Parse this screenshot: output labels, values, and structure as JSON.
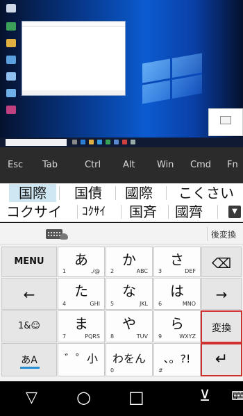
{
  "desktop": {
    "icons": [
      {
        "name": "recycle-bin-icon",
        "caption": ""
      },
      {
        "name": "app-icon",
        "caption": ""
      },
      {
        "name": "file-icon",
        "caption": ""
      },
      {
        "name": "app-icon",
        "caption": ""
      },
      {
        "name": "computer-icon",
        "caption": ""
      },
      {
        "name": "network-icon",
        "caption": ""
      },
      {
        "name": "app-icon",
        "caption": ""
      }
    ],
    "notepad": {
      "title": "",
      "menu": "",
      "text": "",
      "status": ""
    },
    "thumbnail_text": "",
    "taskbar": {
      "search_placeholder": "",
      "tray": ""
    }
  },
  "function_keys": [
    "Esc",
    "Tab",
    "Ctrl",
    "Alt",
    "Win",
    "Cmd",
    "Fn"
  ],
  "candidates": {
    "row1": [
      "国際",
      "国債",
      "國際",
      "こくさい"
    ],
    "row2": [
      "コクサイ",
      "ｺｸｻｲ",
      "国斉",
      "國齊"
    ],
    "selected_index": 0
  },
  "toolbar": {
    "gohenkan": "後変換"
  },
  "keyboard": {
    "menu": "MENU",
    "backspace": "⌫",
    "left": "←",
    "right": "→",
    "mode_123": "1&☺",
    "henkan": "変換",
    "mode_kana": "あA",
    "enter": "↵",
    "keys": [
      {
        "main": "あ",
        "num": "1",
        "sub": "./@"
      },
      {
        "main": "か",
        "num": "2",
        "sub": "ABC"
      },
      {
        "main": "さ",
        "num": "3",
        "sub": "DEF"
      },
      {
        "main": "た",
        "num": "4",
        "sub": "GHI"
      },
      {
        "main": "な",
        "num": "5",
        "sub": "JKL"
      },
      {
        "main": "は",
        "num": "6",
        "sub": "MNO"
      },
      {
        "main": "ま",
        "num": "7",
        "sub": "PQRS"
      },
      {
        "main": "や",
        "num": "8",
        "sub": "TUV"
      },
      {
        "main": "ら",
        "num": "9",
        "sub": "WXYZ"
      },
      {
        "main": "゛゜小",
        "num": "",
        "sub": ""
      },
      {
        "main": "わをん",
        "num": "0",
        "sub": ""
      },
      {
        "main": "、。?!",
        "num": "#",
        "sub": ""
      }
    ]
  },
  "navbar": {
    "back": "▽",
    "home": "○",
    "recents": "□",
    "hide_keyboard": "⊻",
    "keyboard_switch": "⌨"
  },
  "colors": {
    "selected_candidate": "#cfe7f2",
    "highlight_border": "#d03030",
    "function_row_bg": "#2b2b2b",
    "kana_mode_accent": "#2a8fd0"
  }
}
